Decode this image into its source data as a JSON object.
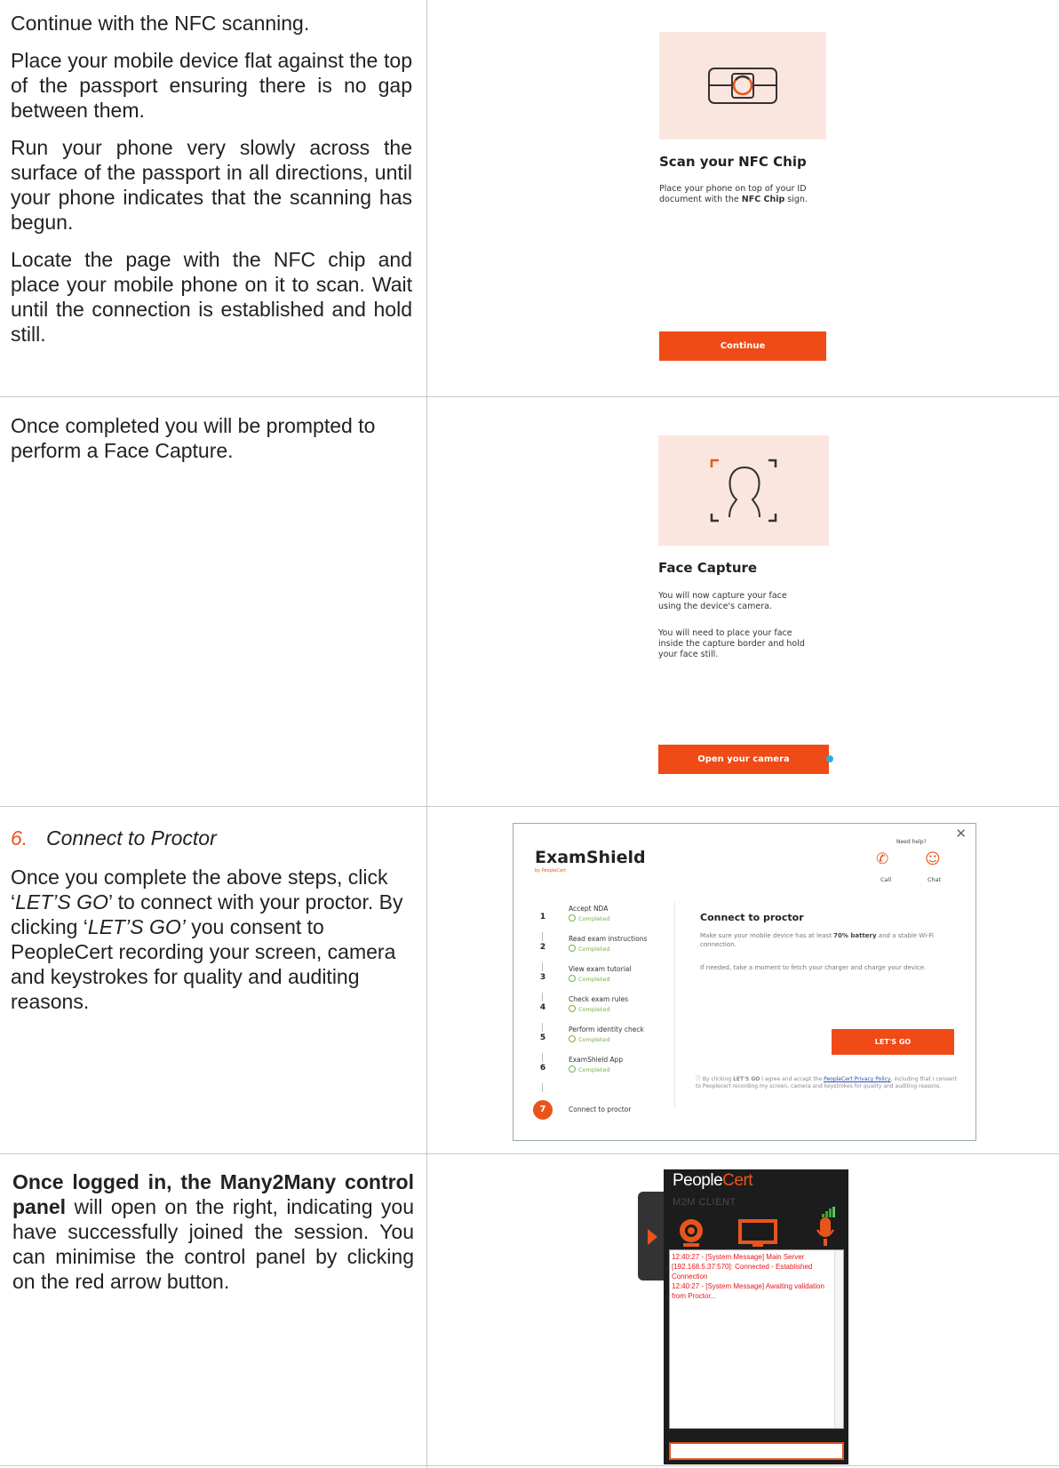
{
  "row1": {
    "paragraphs": [
      "Continue with the NFC scanning.",
      "Place your mobile device flat against the top of the passport ensuring there is no gap between them.",
      "Run your phone very slowly across the surface of the passport in all directions, until your phone indicates that the scanning has begun.",
      "Locate the page with the NFC chip and place your mobile phone on it to scan. Wait until the connection is established and hold still."
    ],
    "card": {
      "icon": "nfc-chip-icon",
      "title": "Scan your NFC Chip",
      "text_before": "Place your phone on top of your ID document with the ",
      "text_bold": "NFC Chip",
      "text_after": " sign.",
      "button": "Continue"
    }
  },
  "row2": {
    "paragraph": "Once completed you will be prompted to perform a Face Capture.",
    "card": {
      "icon": "face-capture-icon",
      "title": "Face Capture",
      "text1": "You will now capture your face using the device's camera.",
      "text2": "You will need to place your face inside the capture border and hold your face still.",
      "button": "Open your camera"
    }
  },
  "row3": {
    "step_number": "6.",
    "step_title": "Connect to Proctor",
    "p_part1": "Once you complete the above steps, click ‘",
    "p_em1": "LET’S GO",
    "p_part2": "’ to connect with your proctor. By clicking ‘",
    "p_em2": "LET’S GO’",
    "p_part3": " you consent to PeopleCert recording your screen, camera and keystrokes for quality and auditing reasons.",
    "window": {
      "app_name": "ExamShield",
      "byline": "by PeopleCert",
      "need_help": "Need help?",
      "call": "Call",
      "chat": "Chat",
      "steps": [
        {
          "num": "1",
          "name": "Accept NDA",
          "status": "Completed"
        },
        {
          "num": "2",
          "name": "Read exam instructions",
          "status": "Completed"
        },
        {
          "num": "3",
          "name": "View exam tutorial",
          "status": "Completed"
        },
        {
          "num": "4",
          "name": "Check exam rules",
          "status": "Completed"
        },
        {
          "num": "5",
          "name": "Perform identity check",
          "status": "Completed"
        },
        {
          "num": "6",
          "name": "ExamShield App",
          "status": "Completed"
        }
      ],
      "current_step": {
        "num": "7",
        "name": "Connect to proctor"
      },
      "heading": "Connect to proctor",
      "p1_before": "Make sure your mobile device has at least ",
      "p1_bold": "70% battery",
      "p1_after": " and a stable Wi-Fi connection.",
      "p2": "If needed, take a moment to fetch your charger and charge your device.",
      "button": "LET'S GO",
      "consent_before": "By clicking ",
      "consent_bold": "LET'S GO",
      "consent_mid": " I agree and accept the ",
      "consent_link": "PeopleCert Privacy Policy",
      "consent_after": ", including that I consent to Peoplecert recording my screen, camera and keystrokes for quality and auditing reasons."
    }
  },
  "row4": {
    "bold": "Once logged in, the Many2Many control panel",
    "rest": " will open on the right, indicating you have successfully joined the session. You can minimise the control panel by clicking on the red arrow button.",
    "panel": {
      "logo_a": "People",
      "logo_b": "Cert",
      "client": "M2M CLIENT",
      "log": "12:40:27 - [System Message] Main Server [192.168.5.37:570]: Connected - Established Connection\n12:40:27 - [System Message] Awaiting validation from Proctor...",
      "accent": "#e8551c"
    }
  }
}
